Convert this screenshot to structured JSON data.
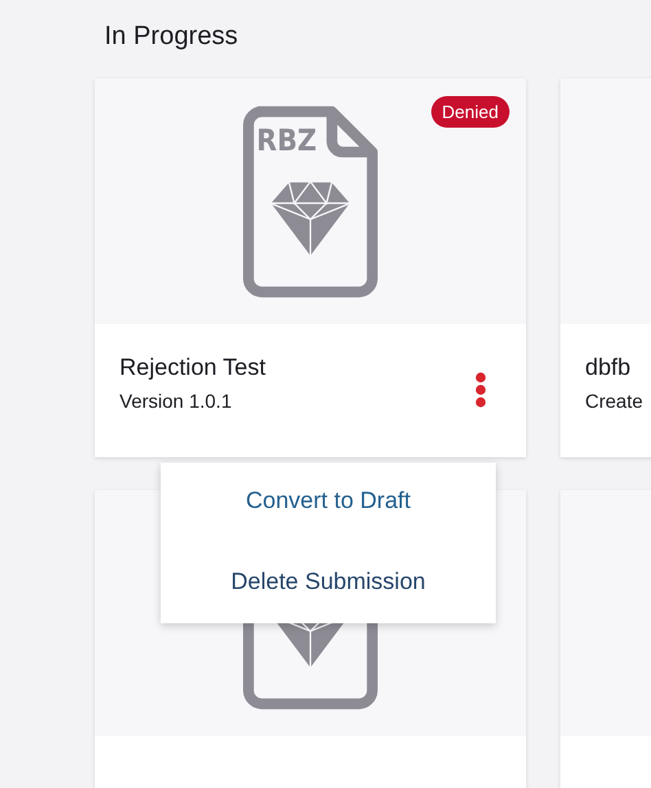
{
  "section": {
    "title": "In Progress"
  },
  "cards": [
    {
      "kind": "file",
      "icon_label": "RBZ",
      "badge": "Denied",
      "title": "Rejection Test",
      "subtitle": "Version 1.0.1",
      "has_menu": true
    },
    {
      "kind": "blank",
      "title": "dbfb",
      "subtitle": "Create"
    },
    {
      "kind": "file",
      "has_menu": false
    },
    {
      "kind": "blank"
    }
  ],
  "menu": {
    "items": [
      {
        "label": "Convert to Draft"
      },
      {
        "label": "Delete Submission"
      }
    ]
  }
}
